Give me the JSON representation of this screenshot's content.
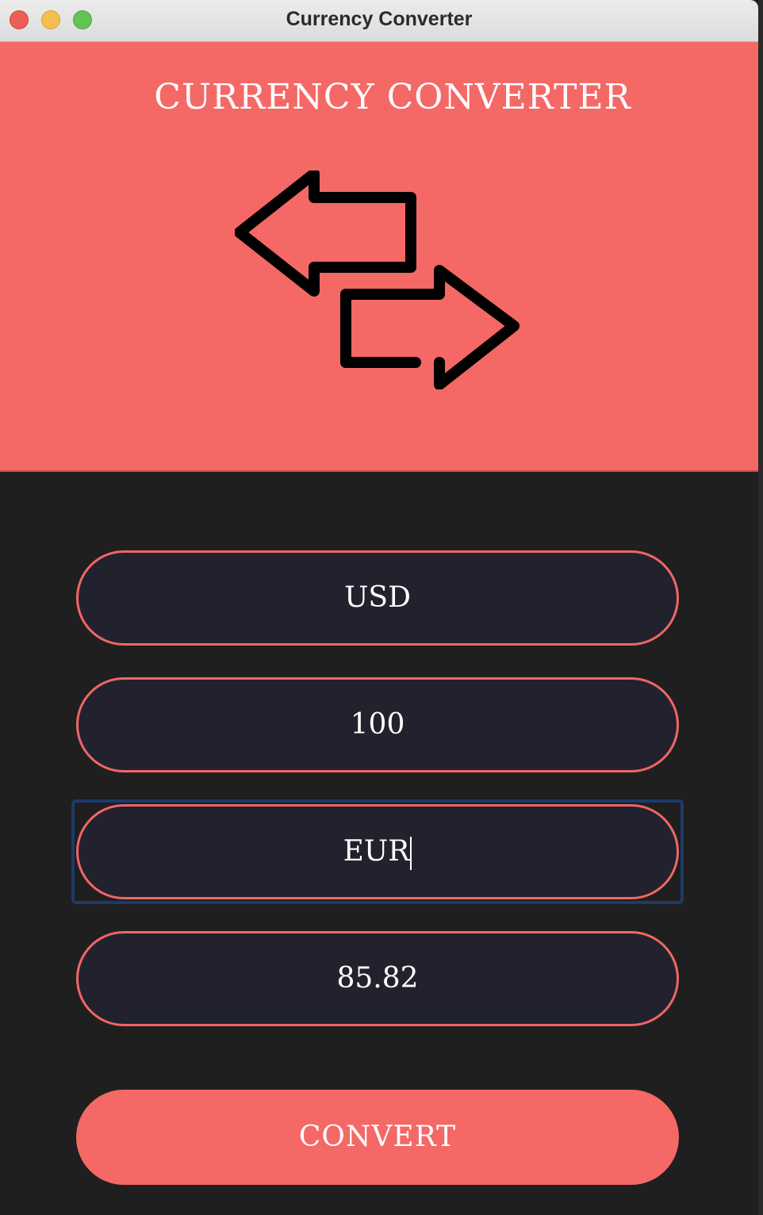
{
  "window": {
    "title": "Currency Converter"
  },
  "hero": {
    "title": "CURRENCY CONVERTER",
    "icon": "swap-arrows-icon"
  },
  "form": {
    "from_currency": "USD",
    "amount": "100",
    "to_currency": "EUR",
    "result": "85.82"
  },
  "actions": {
    "convert_label": "CONVERT"
  },
  "colors": {
    "accent": "#f46866",
    "background": "#1f1f1f",
    "field_background": "#22222e",
    "focus": "#1d3a6b"
  }
}
